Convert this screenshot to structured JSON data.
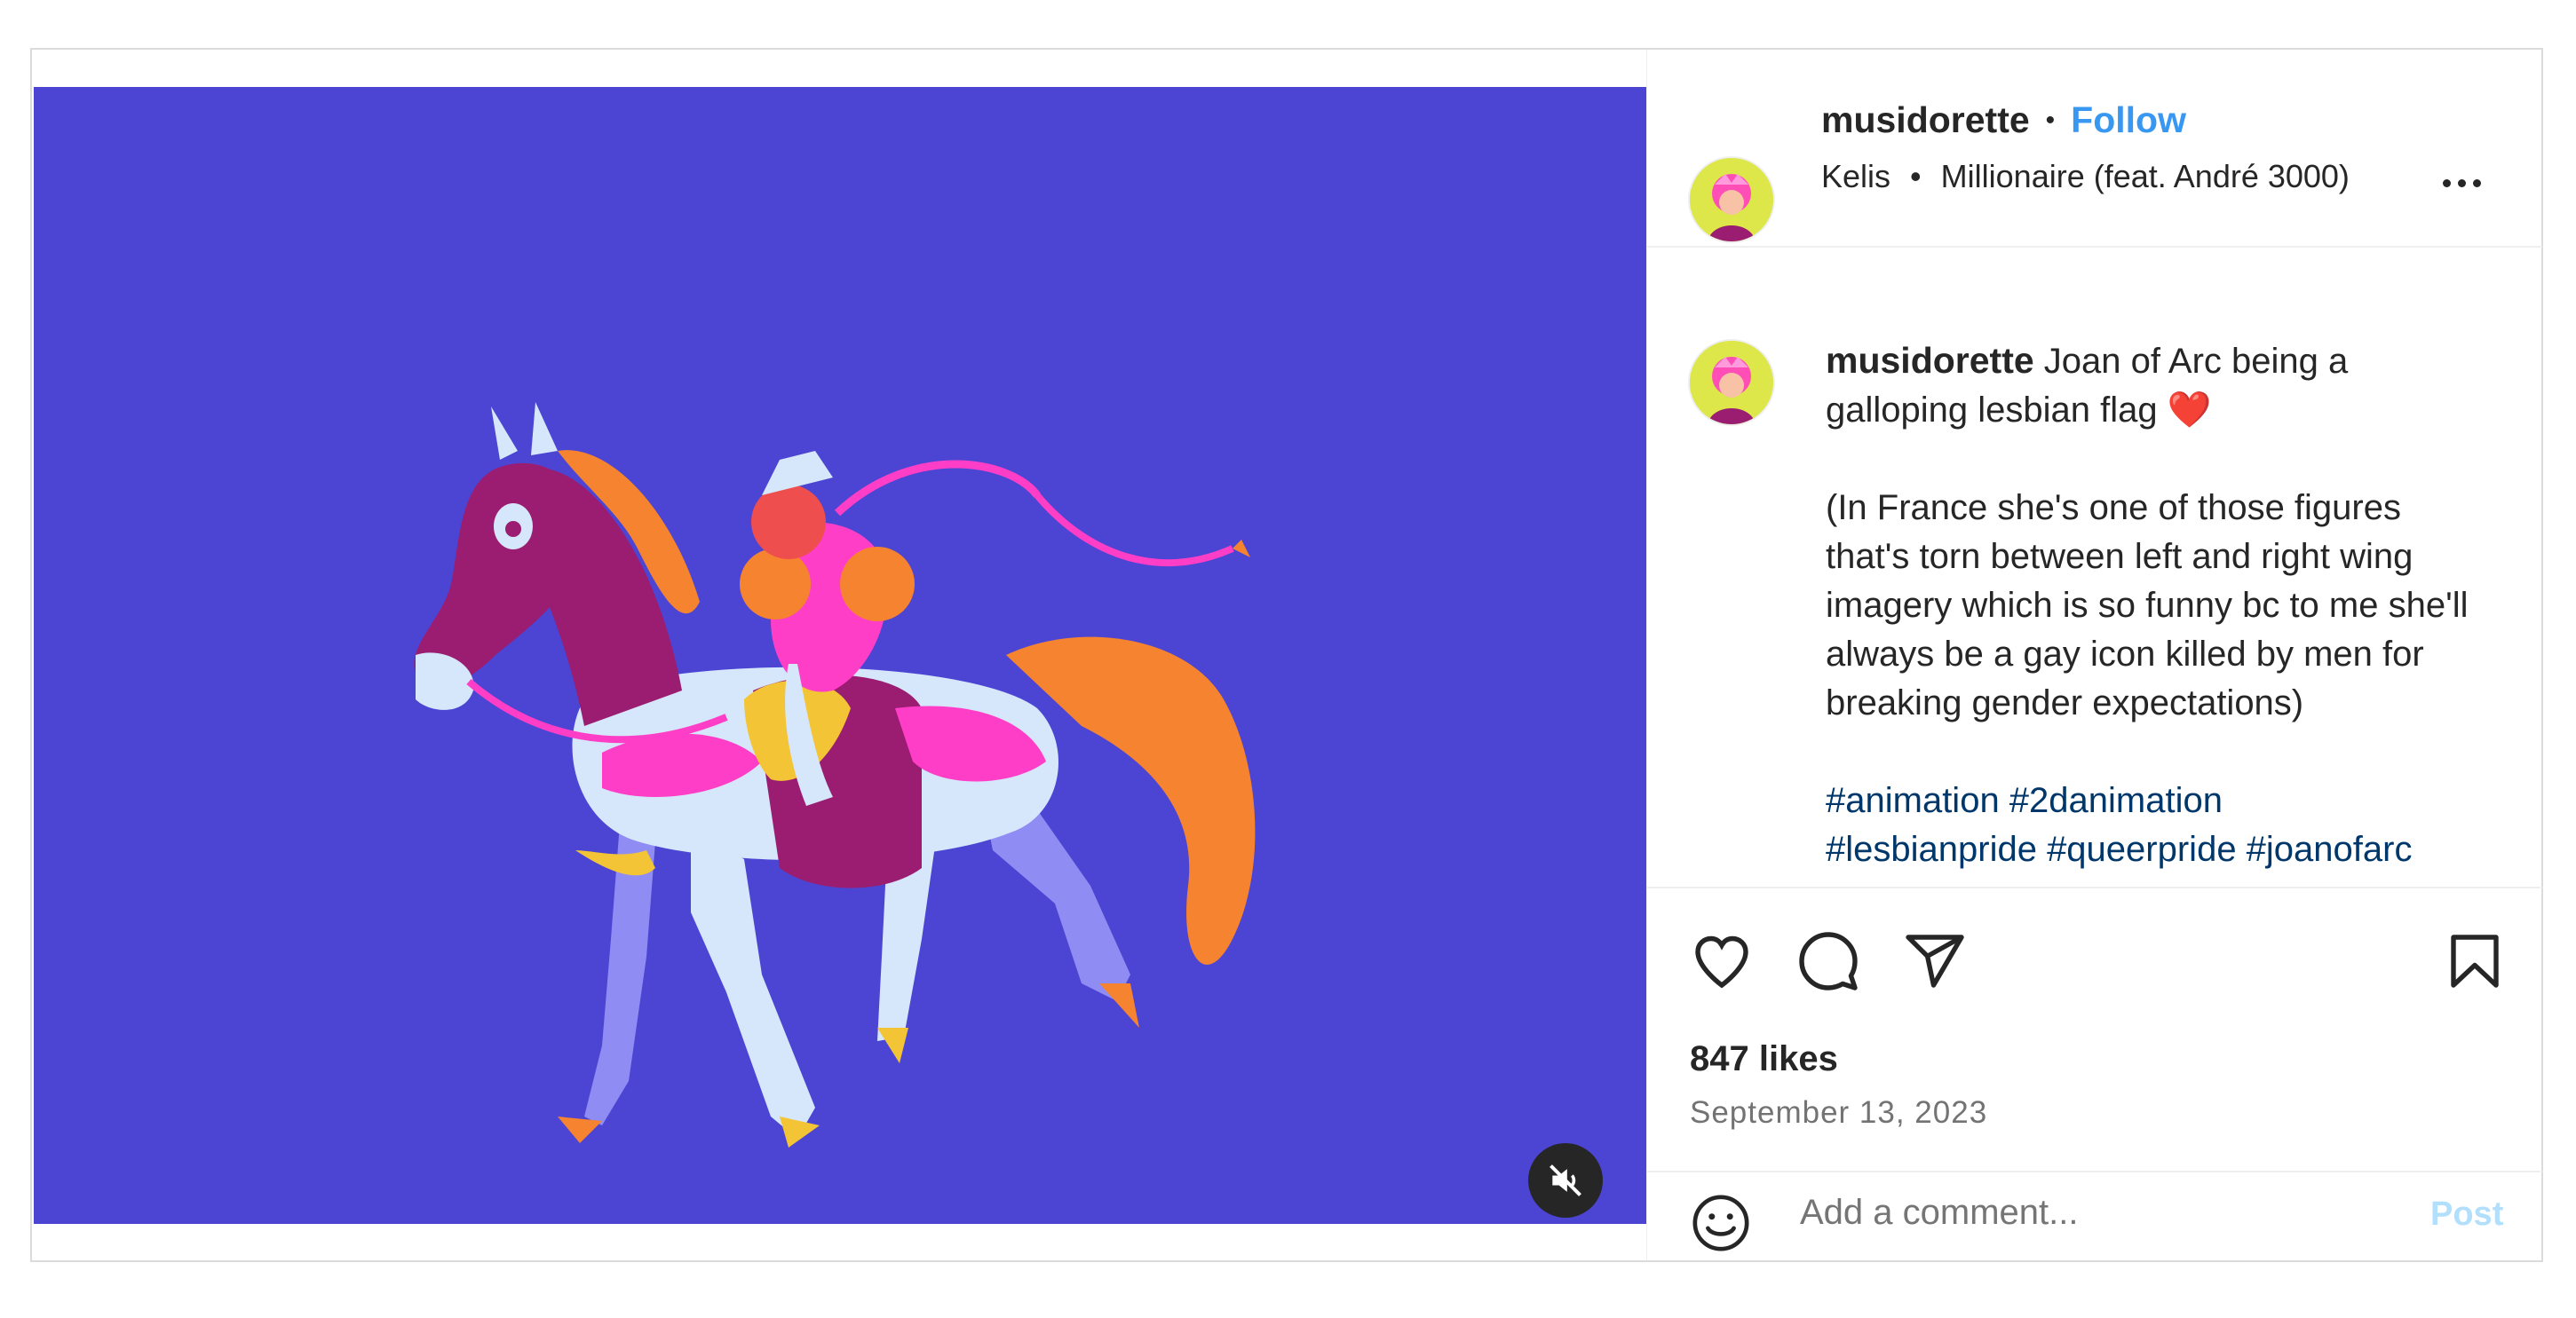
{
  "post": {
    "username": "musidorette",
    "follow_label": "Follow",
    "separator": "•",
    "audio_artist": "Kelis",
    "audio_track": "Millionaire (feat. André 3000)",
    "caption_text": "Joan of Arc being a galloping lesbian flag",
    "caption_emoji": "❤️",
    "caption_paragraph": "(In France she's one of those figures that's torn between left and right wing imagery which is so funny bc to me she'll always be a gay icon killed by men for breaking gender expectations)",
    "hashtags_line1": "#animation #2danimation",
    "hashtags_line2": "#lesbianpride #queerpride #joanofarc",
    "likes": "847 likes",
    "date": "September 13, 2023",
    "comment_placeholder": "Add a comment...",
    "post_label": "Post"
  },
  "icons": {
    "more": "more-options-icon",
    "mute": "muted-speaker-icon",
    "like": "heart-icon",
    "comment": "comment-bubble-icon",
    "share": "paper-plane-icon",
    "save": "bookmark-icon",
    "emoji": "smiley-icon"
  },
  "colors": {
    "media_background": "#4c45d3",
    "follow": "#3897f0",
    "hashtag": "#00376b",
    "post_disabled": "#b2dffc"
  }
}
